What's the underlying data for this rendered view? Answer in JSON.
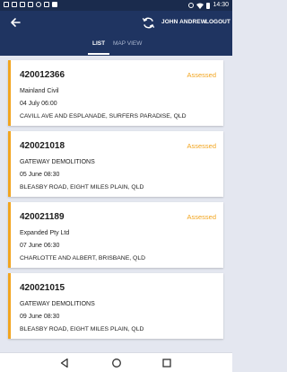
{
  "status_bar": {
    "time": "14:30",
    "left_icons": [
      "screenshot-icon",
      "image-icon",
      "sd-card-icon",
      "photo-icon",
      "robot-icon",
      "gallery-icon",
      "lock-icon"
    ],
    "right_icons": [
      "do-not-disturb-icon",
      "wifi-icon",
      "battery-icon"
    ]
  },
  "header": {
    "back_icon": "arrow-left-icon",
    "refresh_icon": "refresh-icon",
    "user_name": "JOHN ANDREW",
    "logout_label": "LOGOUT"
  },
  "tabs": [
    {
      "label": "LIST",
      "active": true
    },
    {
      "label": "MAP VIEW",
      "active": false
    }
  ],
  "jobs": [
    {
      "number": "420012366",
      "status": "Assessed",
      "company": "Mainland Civil",
      "date": "04 July 06:00",
      "address": "CAVILL AVE AND ESPLANADE, SURFERS PARADISE, QLD"
    },
    {
      "number": "420021018",
      "status": "Assessed",
      "company": "GATEWAY DEMOLITIONS",
      "date": "05 June 08:30",
      "address": "BLEASBY ROAD, EIGHT MILES PLAIN, QLD"
    },
    {
      "number": "420021189",
      "status": "Assessed",
      "company": "Expanded Pty Ltd",
      "date": "07 June 06:30",
      "address": "CHARLOTTE AND ALBERT, BRISBANE, QLD"
    },
    {
      "number": "420021015",
      "status": "",
      "company": "GATEWAY DEMOLITIONS",
      "date": "09 June 08:30",
      "address": "BLEASBY ROAD, EIGHT MILES PLAIN, QLD"
    }
  ],
  "nav_bar": {
    "icons": [
      "back-triangle-icon",
      "home-circle-icon",
      "recents-square-icon"
    ]
  },
  "colors": {
    "header_bg": "#1f3461",
    "status_bar_bg": "#1a2b4d",
    "accent": "#f2a51f",
    "list_bg": "#e4e7f0"
  }
}
